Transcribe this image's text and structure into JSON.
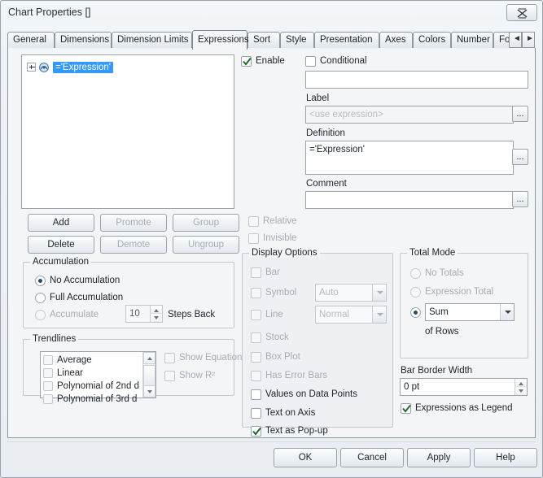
{
  "window": {
    "title": "Chart Properties []",
    "close_icon": "close-icon"
  },
  "tabs": [
    {
      "label": "General",
      "active": false
    },
    {
      "label": "Dimensions",
      "active": false
    },
    {
      "label": "Dimension Limits",
      "active": false
    },
    {
      "label": "Expressions",
      "active": true
    },
    {
      "label": "Sort",
      "active": false
    },
    {
      "label": "Style",
      "active": false
    },
    {
      "label": "Presentation",
      "active": false
    },
    {
      "label": "Axes",
      "active": false
    },
    {
      "label": "Colors",
      "active": false
    },
    {
      "label": "Number",
      "active": false
    },
    {
      "label": "Font",
      "active": false
    }
  ],
  "tab_scroll": {
    "left": "◄",
    "right": "►"
  },
  "expression_tree": {
    "items": [
      {
        "label": "='Expression'",
        "selected": true,
        "expander": "plus-icon",
        "icon": "expression-icon"
      }
    ]
  },
  "list_buttons": [
    {
      "label": "Add",
      "enabled": true
    },
    {
      "label": "Promote",
      "enabled": false
    },
    {
      "label": "Group",
      "enabled": false
    },
    {
      "label": "Delete",
      "enabled": true
    },
    {
      "label": "Demote",
      "enabled": false
    },
    {
      "label": "Ungroup",
      "enabled": false
    }
  ],
  "accumulation": {
    "legend": "Accumulation",
    "options": [
      {
        "label": "No Accumulation",
        "selected": true,
        "enabled": true
      },
      {
        "label": "Full Accumulation",
        "selected": false,
        "enabled": true
      },
      {
        "label": "Accumulate",
        "selected": false,
        "enabled": true
      }
    ],
    "steps_value": "10",
    "steps_label": "Steps Back"
  },
  "trendlines": {
    "legend": "Trendlines",
    "items": [
      {
        "label": "Average",
        "checked": false
      },
      {
        "label": "Linear",
        "checked": false
      },
      {
        "label": "Polynomial of 2nd d",
        "checked": false
      },
      {
        "label": "Polynomial of 3rd d",
        "checked": false
      }
    ],
    "show_equation": {
      "label": "Show Equation",
      "checked": false,
      "enabled": false
    },
    "show_r2": {
      "label": "Show R²",
      "checked": false,
      "enabled": false
    }
  },
  "right_panel": {
    "enable": {
      "label": "Enable",
      "checked": true
    },
    "conditional": {
      "label": "Conditional",
      "checked": false
    },
    "conditional_value": "",
    "label_field": {
      "label": "Label",
      "value": "",
      "placeholder": "<use expression>"
    },
    "definition_field": {
      "label": "Definition",
      "value": "='Expression'"
    },
    "comment_field": {
      "label": "Comment",
      "value": ""
    },
    "ellipsis": "...",
    "relative": {
      "label": "Relative",
      "checked": false,
      "enabled": false
    },
    "invisible": {
      "label": "Invisible",
      "checked": false,
      "enabled": false
    }
  },
  "display_options": {
    "legend": "Display Options",
    "items": [
      {
        "label": "Bar",
        "checked": false,
        "enabled": false
      },
      {
        "label": "Symbol",
        "checked": false,
        "enabled": false,
        "combo": "Auto"
      },
      {
        "label": "Line",
        "checked": false,
        "enabled": false,
        "combo": "Normal"
      },
      {
        "label": "Stock",
        "checked": false,
        "enabled": false
      },
      {
        "label": "Box Plot",
        "checked": false,
        "enabled": false
      },
      {
        "label": "Has Error Bars",
        "checked": false,
        "enabled": false
      },
      {
        "label": "Values on Data Points",
        "checked": false,
        "enabled": true
      },
      {
        "label": "Text on Axis",
        "checked": false,
        "enabled": true
      },
      {
        "label": "Text as Pop-up",
        "checked": true,
        "enabled": true
      }
    ]
  },
  "total_mode": {
    "legend": "Total Mode",
    "options": [
      {
        "label": "No Totals",
        "selected": false,
        "enabled": false
      },
      {
        "label": "Expression Total",
        "selected": false,
        "enabled": false
      },
      {
        "label": "",
        "selected": true,
        "enabled": true,
        "combo": "Sum"
      }
    ],
    "of_rows_label": "of Rows"
  },
  "bar_border_width": {
    "label": "Bar Border Width",
    "value": "0 pt"
  },
  "expressions_as_legend": {
    "label": "Expressions as Legend",
    "checked": true
  },
  "footer_buttons": [
    {
      "label": "OK"
    },
    {
      "label": "Cancel"
    },
    {
      "label": "Apply"
    },
    {
      "label": "Help"
    }
  ],
  "colors": {
    "selection": "#3399ff",
    "checkmark": "#1f6b2b",
    "window_bg": "#f0f0f0",
    "panel_bg": "#f3f5f7",
    "border": "#9aa3ad"
  }
}
